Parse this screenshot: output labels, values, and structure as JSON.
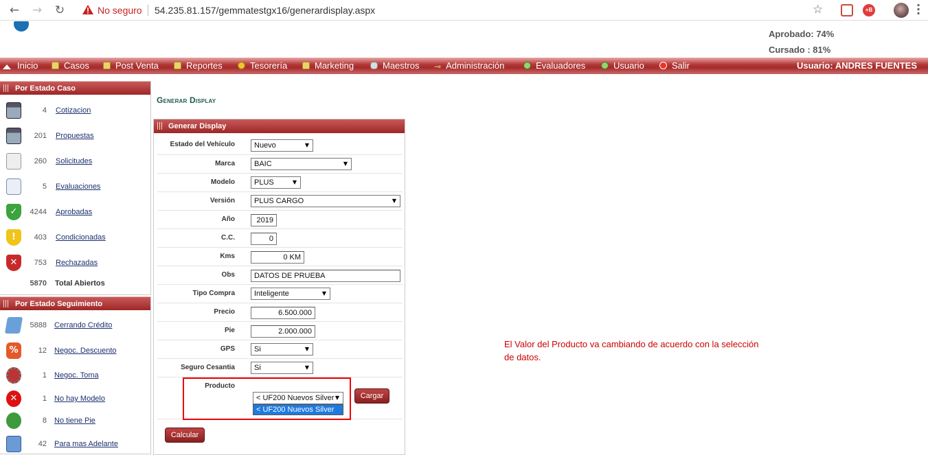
{
  "browser": {
    "security_label": "No seguro",
    "url": "54.235.81.157/gemmatestgx16/generardisplay.aspx",
    "ext_label": "+B"
  },
  "header": {
    "approved": "Aprobado: 74%",
    "studied": "Cursado : 81%"
  },
  "menu": {
    "items": [
      "Inicio",
      "Casos",
      "Post Venta",
      "Reportes",
      "Tesorería",
      "Marketing",
      "Maestros",
      "Administración",
      "Evaluadores",
      "Usuario",
      "Salir"
    ],
    "user": "Usuario:  ANDRES FUENTES"
  },
  "sidebar": {
    "estado_caso": {
      "title": "Por Estado Caso",
      "items": [
        {
          "count": "4",
          "label": "Cotizacion",
          "icon": "calculator-icon"
        },
        {
          "count": "201",
          "label": "Propuestas",
          "icon": "calculator-icon"
        },
        {
          "count": "260",
          "label": "Solicitudes",
          "icon": "document-icon"
        },
        {
          "count": "5",
          "label": "Evaluaciones",
          "icon": "magnifier-icon"
        },
        {
          "count": "4244",
          "label": "Aprobadas",
          "icon": "green-shield-icon"
        },
        {
          "count": "403",
          "label": "Condicionadas",
          "icon": "yellow-shield-icon"
        },
        {
          "count": "753",
          "label": "Rechazadas",
          "icon": "red-shield-icon"
        }
      ],
      "total_count": "5870",
      "total_label": "Total Abiertos"
    },
    "estado_seguimiento": {
      "title": "Por Estado Seguimiento",
      "items": [
        {
          "count": "5888",
          "label": "Cerrando Crédito",
          "icon": "notes-icon"
        },
        {
          "count": "12",
          "label": "Negoc. Descuento",
          "icon": "percent-tag-icon"
        },
        {
          "count": "1",
          "label": "Negoc. Toma",
          "icon": "gear-icon"
        },
        {
          "count": "1",
          "label": "No hay Modelo",
          "icon": "red-x-icon"
        },
        {
          "count": "8",
          "label": "No tiene Pie",
          "icon": "money-icon"
        },
        {
          "count": "42",
          "label": "Para mas Adelante",
          "icon": "calendar-icon"
        }
      ]
    }
  },
  "main": {
    "page_title": "Generar Display",
    "panel_title": "Generar Display",
    "fields": {
      "estado": {
        "label": "Estado del Vehículo",
        "value": "Nuevo"
      },
      "marca": {
        "label": "Marca",
        "value": "BAIC"
      },
      "modelo": {
        "label": "Modelo",
        "value": "PLUS"
      },
      "version": {
        "label": "Versión",
        "value": "PLUS CARGO"
      },
      "anio": {
        "label": "Año",
        "value": "2019"
      },
      "cc": {
        "label": "C.C.",
        "value": "0"
      },
      "kms": {
        "label": "Kms",
        "value": "0 KM"
      },
      "obs": {
        "label": "Obs",
        "value": "DATOS DE PRUEBA"
      },
      "tipo_compra": {
        "label": "Tipo Compra",
        "value": "Inteligente"
      },
      "precio": {
        "label": "Precio",
        "value": "6.500.000"
      },
      "pie": {
        "label": "Pie",
        "value": "2.000.000"
      },
      "gps": {
        "label": "GPS",
        "value": "Si"
      },
      "seguro": {
        "label": "Seguro Cesantia",
        "value": "Si"
      },
      "producto": {
        "label": "Producto",
        "value": "< UF200 Nuevos Silver",
        "option_highlighted": "< UF200 Nuevos Silver"
      }
    },
    "cargar_label": "Cargar",
    "calcular_label": "Calcular"
  },
  "annotation": {
    "text": "El Valor del Producto va cambiando de acuerdo con la selección de datos."
  }
}
